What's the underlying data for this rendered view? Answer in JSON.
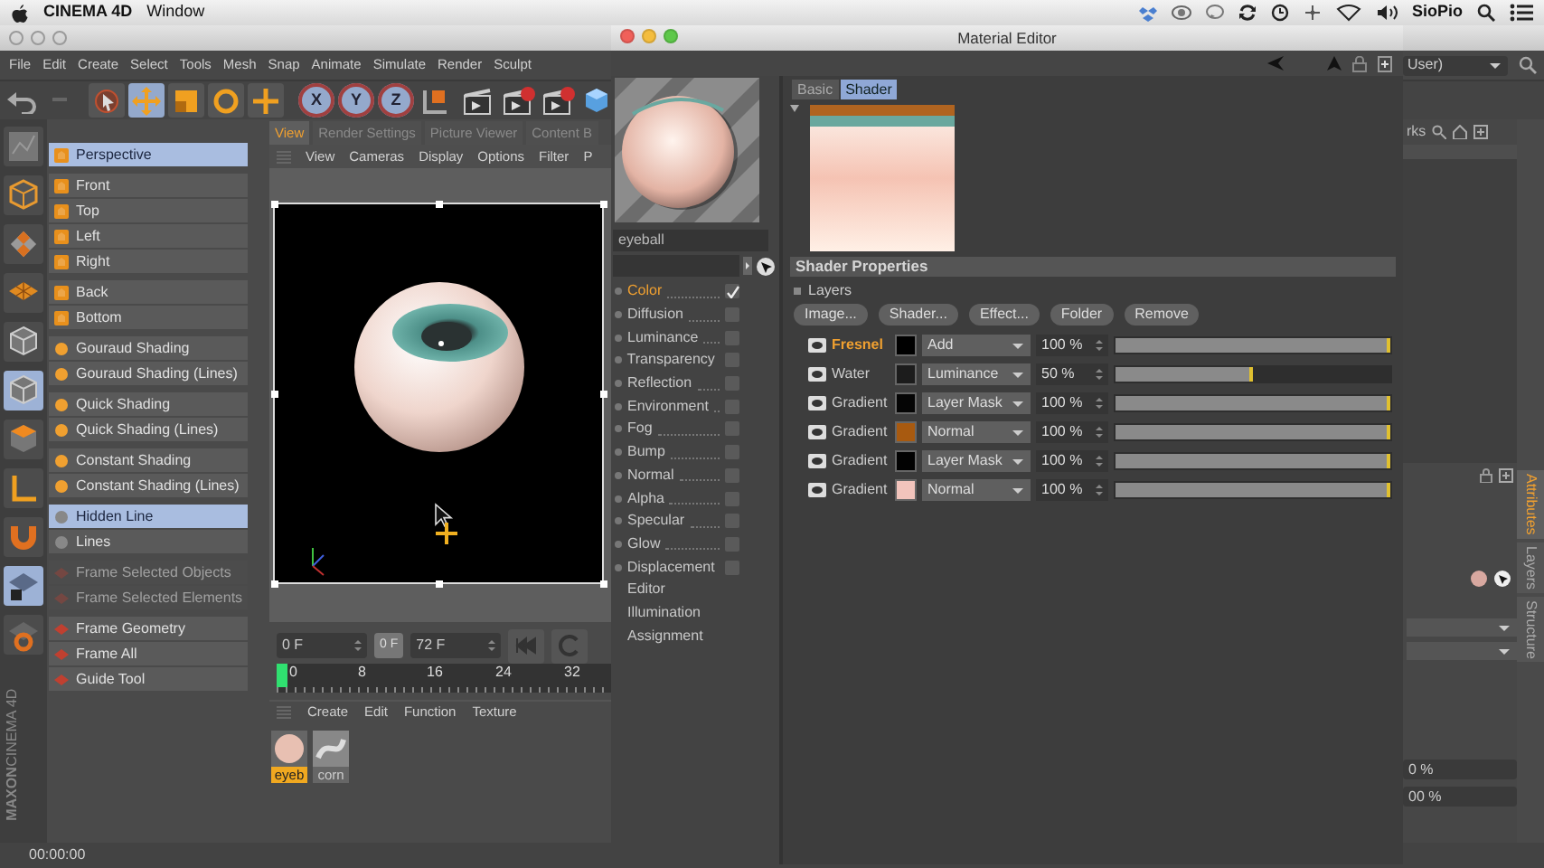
{
  "system_menubar": {
    "app_name": "CINEMA 4D",
    "menus": [
      "Window"
    ],
    "user_name": "SioPio"
  },
  "main_window": {
    "menus": [
      "File",
      "Edit",
      "Create",
      "Select",
      "Tools",
      "Mesh",
      "Snap",
      "Animate",
      "Simulate",
      "Render",
      "Sculpt"
    ],
    "layout_dropdown": "User)",
    "tools": [
      {
        "kind": "select",
        "selected": false
      },
      {
        "kind": "move",
        "selected": true
      },
      {
        "kind": "scale",
        "selected": false
      },
      {
        "kind": "rotate",
        "selected": false
      },
      {
        "kind": "add",
        "selected": false
      }
    ],
    "axes": [
      {
        "label": "X",
        "on": true
      },
      {
        "label": "Y",
        "on": true
      },
      {
        "label": "Z",
        "on": true
      }
    ],
    "side_tools": [
      {
        "kind": "points",
        "selected": false
      },
      {
        "kind": "cube-outline",
        "selected": false
      },
      {
        "kind": "tile",
        "selected": false
      },
      {
        "kind": "grid",
        "selected": false
      },
      {
        "kind": "cube",
        "selected": false
      },
      {
        "kind": "cube",
        "selected": true
      },
      {
        "kind": "cube-solid",
        "selected": false
      },
      {
        "kind": "axis",
        "selected": false
      },
      {
        "kind": "magnet",
        "selected": false
      },
      {
        "kind": "grid-lock",
        "selected": true
      },
      {
        "kind": "grid-gear",
        "selected": false
      }
    ],
    "logo": {
      "brand": "MAXON",
      "product": "CINEMA 4D"
    },
    "view_menu": [
      {
        "kind": "camera",
        "items": [
          {
            "label": "Perspective",
            "selected": true,
            "disabled": false
          }
        ]
      },
      {
        "kind": "camera",
        "items": [
          {
            "label": "Front",
            "selected": false,
            "disabled": false
          },
          {
            "label": "Top",
            "selected": false,
            "disabled": false
          },
          {
            "label": "Left",
            "selected": false,
            "disabled": false
          },
          {
            "label": "Right",
            "selected": false,
            "disabled": false
          }
        ]
      },
      {
        "kind": "camera",
        "items": [
          {
            "label": "Back",
            "selected": false,
            "disabled": false
          },
          {
            "label": "Bottom",
            "selected": false,
            "disabled": false
          }
        ]
      },
      {
        "kind": "shading",
        "items": [
          {
            "label": "Gouraud Shading",
            "selected": false,
            "disabled": false
          },
          {
            "label": "Gouraud Shading (Lines)",
            "selected": false,
            "disabled": false
          }
        ]
      },
      {
        "kind": "shading",
        "items": [
          {
            "label": "Quick Shading",
            "selected": false,
            "disabled": false
          },
          {
            "label": "Quick Shading (Lines)",
            "selected": false,
            "disabled": false
          }
        ]
      },
      {
        "kind": "shading",
        "items": [
          {
            "label": "Constant Shading",
            "selected": false,
            "disabled": false
          },
          {
            "label": "Constant Shading (Lines)",
            "selected": false,
            "disabled": false
          }
        ]
      },
      {
        "kind": "line",
        "items": [
          {
            "label": "Hidden Line",
            "selected": true,
            "disabled": false
          },
          {
            "label": "Lines",
            "selected": false,
            "disabled": false
          }
        ]
      },
      {
        "kind": "frame",
        "items": [
          {
            "label": "Frame Selected Objects",
            "selected": false,
            "disabled": true
          },
          {
            "label": "Frame Selected Elements",
            "selected": false,
            "disabled": true
          }
        ]
      },
      {
        "kind": "frame",
        "items": [
          {
            "label": "Frame Geometry",
            "selected": false,
            "disabled": false
          },
          {
            "label": "Frame All",
            "selected": false,
            "disabled": false
          },
          {
            "label": "Guide Tool",
            "selected": false,
            "disabled": false
          }
        ]
      }
    ],
    "viewport": {
      "tabs": [
        {
          "label": "View",
          "selected": true
        },
        {
          "label": "Render Settings",
          "selected": false
        },
        {
          "label": "Picture Viewer",
          "selected": false
        },
        {
          "label": "Content B",
          "selected": false
        }
      ],
      "menus": [
        "View",
        "Cameras",
        "Display",
        "Options",
        "Filter",
        "P"
      ]
    },
    "timeline": {
      "start": "0 F",
      "current": "0 F",
      "end": "72 F",
      "ruler_labels": [
        "0",
        "8",
        "16",
        "24",
        "32"
      ]
    },
    "material_manager": {
      "menus": [
        "Create",
        "Edit",
        "Function",
        "Texture"
      ],
      "materials": [
        {
          "name": "eyeb",
          "selected": true
        },
        {
          "name": "corn",
          "selected": false
        }
      ]
    },
    "right_panel": {
      "header": "rks",
      "tabs": [
        {
          "label": "Attributes",
          "selected": true
        },
        {
          "label": "Layers",
          "selected": false
        },
        {
          "label": "Structure",
          "selected": false
        }
      ],
      "fields": [
        "0 %",
        "00 %"
      ]
    },
    "status_bar": "00:00:00"
  },
  "material_editor": {
    "title": "Material Editor",
    "material_name": "eyeball",
    "channels": [
      {
        "kind": "toggle",
        "label": "Color",
        "selected": true,
        "checked": true
      },
      {
        "kind": "toggle",
        "label": "Diffusion",
        "selected": false,
        "checked": false
      },
      {
        "kind": "toggle",
        "label": "Luminance",
        "selected": false,
        "checked": false
      },
      {
        "kind": "toggle",
        "label": "Transparency",
        "selected": false,
        "checked": false
      },
      {
        "kind": "toggle",
        "label": "Reflection",
        "selected": false,
        "checked": false
      },
      {
        "kind": "toggle",
        "label": "Environment",
        "selected": false,
        "checked": false
      },
      {
        "kind": "toggle",
        "label": "Fog",
        "selected": false,
        "checked": false
      },
      {
        "kind": "toggle",
        "label": "Bump",
        "selected": false,
        "checked": false
      },
      {
        "kind": "toggle",
        "label": "Normal",
        "selected": false,
        "checked": false
      },
      {
        "kind": "toggle",
        "label": "Alpha",
        "selected": false,
        "checked": false
      },
      {
        "kind": "toggle",
        "label": "Specular",
        "selected": false,
        "checked": false
      },
      {
        "kind": "toggle",
        "label": "Glow",
        "selected": false,
        "checked": false
      },
      {
        "kind": "toggle",
        "label": "Displacement",
        "selected": false,
        "checked": false
      },
      {
        "kind": "page",
        "label": "Editor",
        "selected": false
      },
      {
        "kind": "page",
        "label": "Illumination",
        "selected": false
      },
      {
        "kind": "page",
        "label": "Assignment",
        "selected": false
      }
    ],
    "tabs": [
      {
        "label": "Basic",
        "selected": false
      },
      {
        "label": "Shader",
        "selected": true
      }
    ],
    "section_title": "Shader Properties",
    "layers_label": "Layers",
    "buttons": [
      "Image...",
      "Shader...",
      "Effect...",
      "Folder",
      "Remove"
    ],
    "layers": [
      {
        "name": "Fresnel",
        "selected": true,
        "color": "#000000",
        "mode": "Add",
        "opacity": "100 %",
        "level": 1
      },
      {
        "name": "Water",
        "selected": false,
        "color": "#1c1c1c",
        "mode": "Luminance",
        "opacity": "50 %",
        "level": 0.5
      },
      {
        "name": "Gradient",
        "selected": false,
        "color": "#050505",
        "mode": "Layer Mask",
        "opacity": "100 %",
        "level": 1
      },
      {
        "name": "Gradient",
        "selected": false,
        "color": "#a85a10",
        "mode": "Normal",
        "opacity": "100 %",
        "level": 1
      },
      {
        "name": "Gradient",
        "selected": false,
        "color": "#020202",
        "mode": "Layer Mask",
        "opacity": "100 %",
        "level": 1
      },
      {
        "name": "Gradient",
        "selected": false,
        "color": "#f2c4bc",
        "mode": "Normal",
        "opacity": "100 %",
        "level": 1
      }
    ]
  }
}
